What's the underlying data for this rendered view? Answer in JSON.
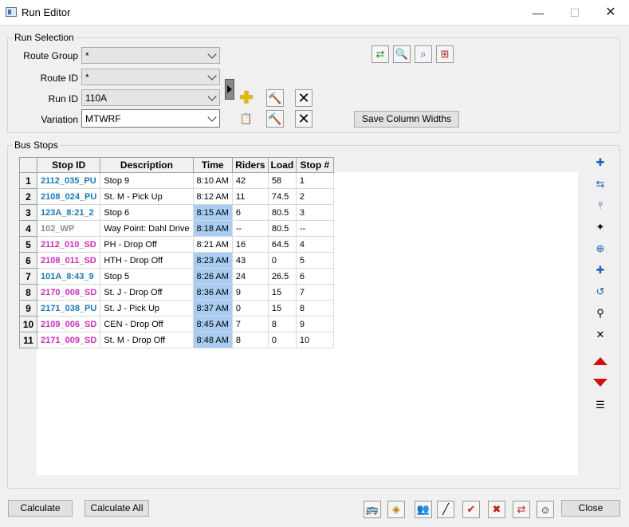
{
  "window": {
    "title": "Run Editor",
    "minimize": "—",
    "maximize": "☐",
    "close": "✕"
  },
  "run_selection": {
    "legend": "Run Selection",
    "route_group": {
      "label": "Route Group",
      "value": "*"
    },
    "route_id": {
      "label": "Route ID",
      "value": "*"
    },
    "run_id": {
      "label": "Run ID",
      "value": "110A"
    },
    "variation": {
      "label": "Variation",
      "value": "MTWRF"
    },
    "save_column_widths": "Save Column Widths",
    "icons": [
      "map-route-icon",
      "magnify-icon",
      "zoom-stops-icon",
      "grid-map-icon",
      "add-run-icon",
      "edit-run-icon",
      "delete-run-icon",
      "copy-variation-icon",
      "edit-variation-icon",
      "delete-variation-icon"
    ]
  },
  "bus_stops": {
    "legend": "Bus Stops",
    "columns": [
      "Stop ID",
      "Description",
      "Time",
      "Riders",
      "Load",
      "Stop #"
    ],
    "rows": [
      {
        "n": "1",
        "stop_id": "2112_035_PU",
        "desc": "Stop 9",
        "time": "8:10 AM",
        "riders": "42",
        "load": "58",
        "stop": "1",
        "color": "blue",
        "hl": false
      },
      {
        "n": "2",
        "stop_id": "2108_024_PU",
        "desc": "St. M - Pick Up",
        "time": "8:12 AM",
        "riders": "11",
        "load": "74.5",
        "stop": "2",
        "color": "blue",
        "hl": false
      },
      {
        "n": "3",
        "stop_id": "123A_8:21_2",
        "desc": "Stop 6",
        "time": "8:15 AM",
        "riders": "6",
        "load": "80.5",
        "stop": "3",
        "color": "blue",
        "hl": true
      },
      {
        "n": "4",
        "stop_id": "102_WP",
        "desc": "Way Point: Dahl Drive",
        "time": "8:18 AM",
        "riders": "--",
        "load": "80.5",
        "stop": "--",
        "color": "gray",
        "hl": true
      },
      {
        "n": "5",
        "stop_id": "2112_010_SD",
        "desc": "PH - Drop Off",
        "time": "8:21 AM",
        "riders": "16",
        "load": "64.5",
        "stop": "4",
        "color": "magenta",
        "hl": false
      },
      {
        "n": "6",
        "stop_id": "2108_011_SD",
        "desc": "HTH - Drop Off",
        "time": "8:23 AM",
        "riders": "43",
        "load": "0",
        "stop": "5",
        "color": "magenta",
        "hl": true
      },
      {
        "n": "7",
        "stop_id": "101A_8:43_9",
        "desc": "Stop 5",
        "time": "8:26 AM",
        "riders": "24",
        "load": "26.5",
        "stop": "6",
        "color": "blue",
        "hl": true
      },
      {
        "n": "8",
        "stop_id": "2170_008_SD",
        "desc": "St. J - Drop Off",
        "time": "8:36 AM",
        "riders": "9",
        "load": "15",
        "stop": "7",
        "color": "magenta",
        "hl": true
      },
      {
        "n": "9",
        "stop_id": "2171_038_PU",
        "desc": "St. J - Pick Up",
        "time": "8:37 AM",
        "riders": "0",
        "load": "15",
        "stop": "8",
        "color": "blue",
        "hl": true
      },
      {
        "n": "10",
        "stop_id": "2109_006_SD",
        "desc": "CEN - Drop Off",
        "time": "8:45 AM",
        "riders": "7",
        "load": "8",
        "stop": "9",
        "color": "magenta",
        "hl": true
      },
      {
        "n": "11",
        "stop_id": "2171_009_SD",
        "desc": "St. M - Drop Off",
        "time": "8:48 AM",
        "riders": "8",
        "load": "0",
        "stop": "10",
        "color": "magenta",
        "hl": true
      }
    ],
    "side_icons": [
      "add-stop-icon",
      "swap-stops-icon",
      "insert-stop-icon",
      "auto-assign-icon",
      "add-to-route-icon",
      "add-waypoint-icon",
      "return-stop-icon",
      "edit-stop-icon",
      "remove-stop-icon",
      "move-up-icon",
      "move-down-icon",
      "reorder-icon"
    ]
  },
  "footer": {
    "calculate": "Calculate",
    "calculate_all": "Calculate All",
    "close": "Close",
    "icons": [
      "bus-add-icon",
      "bus-route-icon",
      "students-icon",
      "wand-icon",
      "rider-assign-icon",
      "rider-remove-icon",
      "rider-swap-icon",
      "driver-icon"
    ]
  },
  "colors": {
    "stop_blue": "#1a78b8",
    "stop_magenta": "#cc2db8",
    "stop_gray": "#8c8c8c",
    "time_highlight": "#a9cdf2",
    "arrow_red": "#d01010"
  }
}
